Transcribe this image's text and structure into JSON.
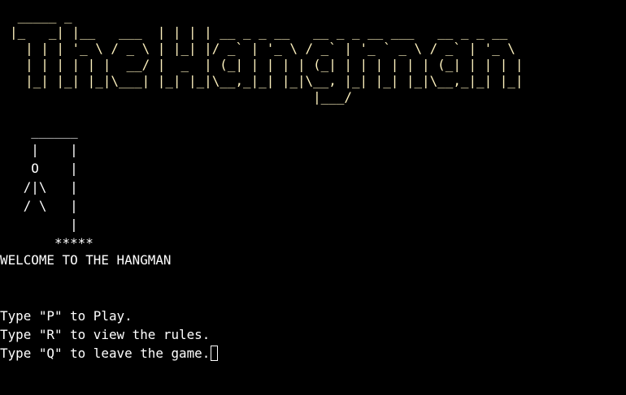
{
  "banner": {
    "lines": [
      " _____ _                                        ",
      "|_   _| |__   ___  | | | | __ _ _ __   __ _ _ __ ___   __ _ _ __  ",
      "  | | | '_ \\ / _ \\ | |_| |/ _` | '_ \\ / _` | '_ ` _ \\ / _` | '_ \\ ",
      "  | | | | | |  __/ |  _  | (_| | | | | (_| | | | | | | (_| | | | |",
      "  |_| |_| |_|\\___| |_| |_|\\__,_|_| |_|\\__, |_| |_| |_|\\__,_|_| |_|",
      "                                       |___/                      "
    ],
    "color": "#fff3bf"
  },
  "gallows": {
    "lines": [
      "    ______",
      "    |    |",
      "    O    |",
      "   /|\\   |",
      "   / \\   |",
      "         |",
      "       *****"
    ]
  },
  "welcome": "WELCOME TO THE HANGMAN",
  "menu": {
    "play": "Type \"P\" to Play.",
    "rules": "Type \"R\" to view the rules.",
    "quit": "Type \"Q\" to leave the game."
  },
  "colors": {
    "background": "#000000",
    "text": "#ffffff",
    "banner": "#fff3bf"
  }
}
